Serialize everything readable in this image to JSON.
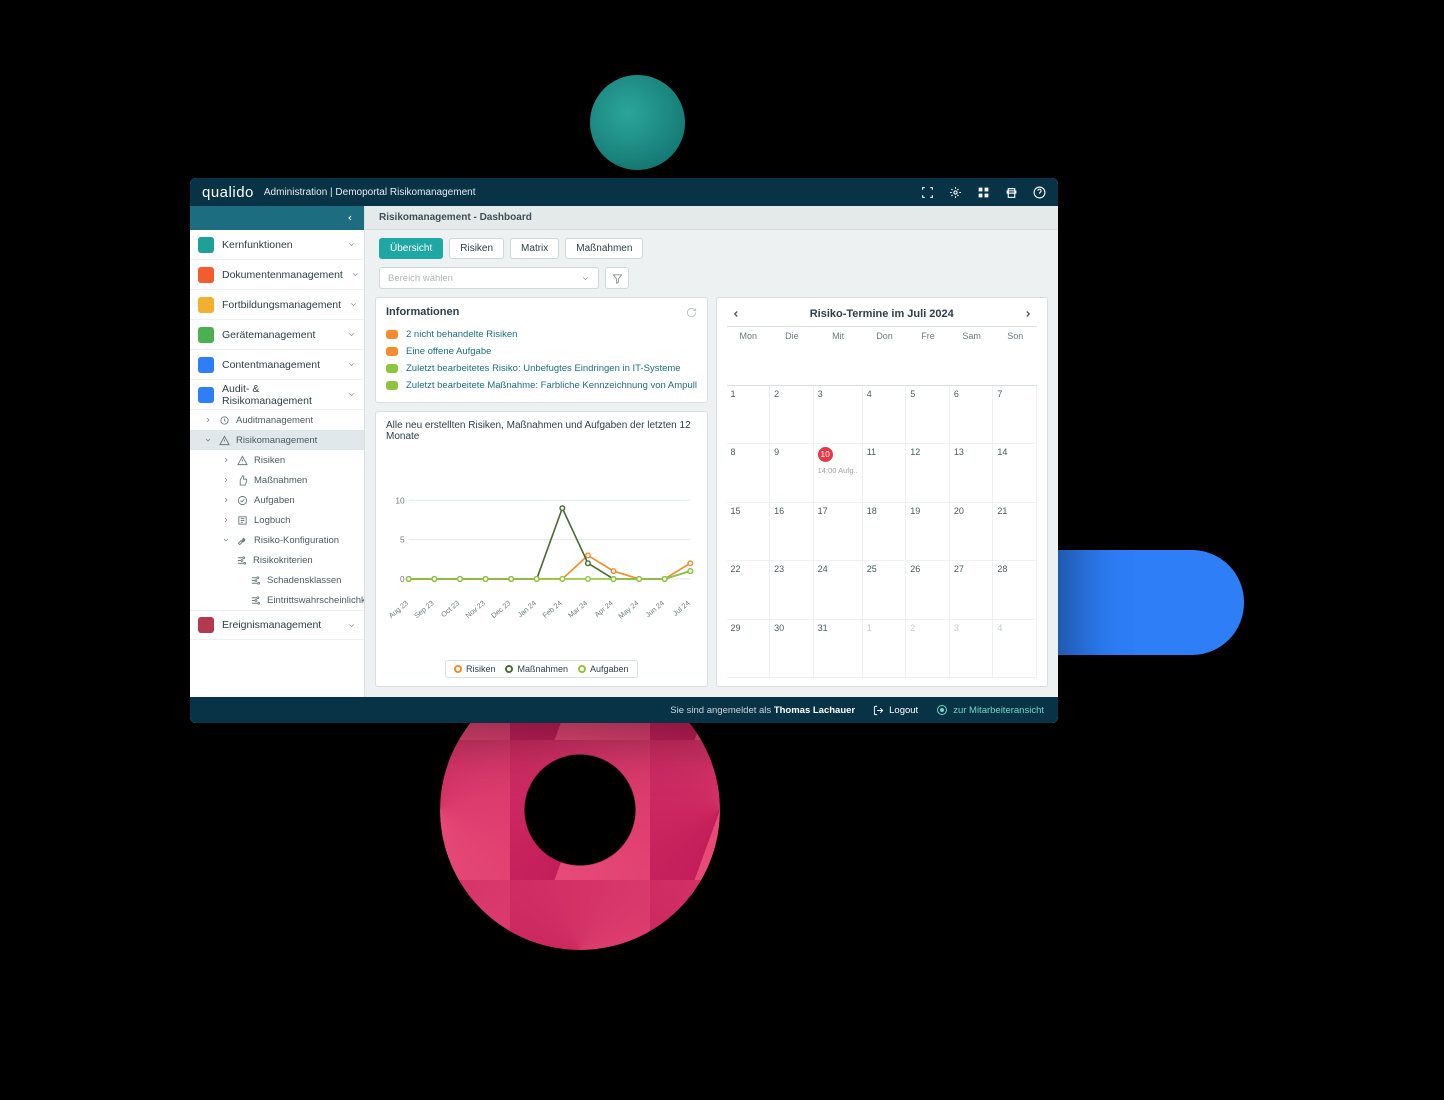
{
  "brand": "qualido",
  "header_subtitle": "Administration | Demoportal Risikomanagement",
  "sidebar": {
    "items": [
      {
        "label": "Kernfunktionen",
        "color": "#1fa096"
      },
      {
        "label": "Dokumentenmanagement",
        "color": "#f25c2e"
      },
      {
        "label": "Fortbildungsmanagement",
        "color": "#f2b02e"
      },
      {
        "label": "Gerätemanagement",
        "color": "#4caf50"
      },
      {
        "label": "Contentmanagement",
        "color": "#2d7ef7"
      },
      {
        "label": "Audit- & Risikomanagement",
        "color": "#2d7ef7"
      },
      {
        "label": "Ereignismanagement",
        "color": "#b33951"
      }
    ],
    "audit_sub": [
      {
        "label": "Auditmanagement",
        "depth": 1,
        "icon": "audit"
      },
      {
        "label": "Risikomanagement",
        "depth": 1,
        "icon": "warning",
        "sel": true
      },
      {
        "label": "Risiken",
        "depth": 2,
        "icon": "warning"
      },
      {
        "label": "Maßnahmen",
        "depth": 2,
        "icon": "thumbs-up"
      },
      {
        "label": "Aufgaben",
        "depth": 2,
        "icon": "check-circle"
      },
      {
        "label": "Logbuch",
        "depth": 2,
        "icon": "log"
      },
      {
        "label": "Risiko-Konfiguration",
        "depth": 2,
        "icon": "wrench"
      },
      {
        "label": "Risikokriterien",
        "depth": 3,
        "icon": "sliders"
      },
      {
        "label": "Schadensklassen",
        "depth": 4,
        "icon": "sliders"
      },
      {
        "label": "Eintrittswahrscheinlichkeit",
        "depth": 4,
        "icon": "sliders"
      }
    ]
  },
  "breadcrumb": "Risikomanagement - Dashboard",
  "tabs": [
    "Übersicht",
    "Risiken",
    "Matrix",
    "Maßnahmen"
  ],
  "active_tab": "Übersicht",
  "select_placeholder": "Bereich wählen",
  "info": {
    "title": "Informationen",
    "rows": [
      {
        "color": "#f28c2e",
        "text": "2 nicht behandelte Risiken"
      },
      {
        "color": "#f28c2e",
        "text": "Eine offene Aufgabe"
      },
      {
        "color": "#8cc63f",
        "text": "Zuletzt bearbeitetes Risiko: Unbefugtes Eindringen in IT-Systeme"
      },
      {
        "color": "#8cc63f",
        "text": "Zuletzt bearbeitete Maßnahme: Farbliche Kennzeichnung von Ampullen je nach Wirk"
      }
    ]
  },
  "calendar": {
    "title": "Risiko-Termine im Juli 2024",
    "dow": [
      "Mon",
      "Die",
      "Mit",
      "Don",
      "Fre",
      "Sam",
      "Son"
    ],
    "weeks": [
      [
        {
          "n": 1
        },
        {
          "n": 2
        },
        {
          "n": 3
        },
        {
          "n": 4
        },
        {
          "n": 5
        },
        {
          "n": 6
        },
        {
          "n": 7
        }
      ],
      [
        {
          "n": 8
        },
        {
          "n": 9
        },
        {
          "n": 10,
          "badge": true,
          "event": "14:00 Aufg.."
        },
        {
          "n": 11
        },
        {
          "n": 12
        },
        {
          "n": 13
        },
        {
          "n": 14
        }
      ],
      [
        {
          "n": 15
        },
        {
          "n": 16
        },
        {
          "n": 17
        },
        {
          "n": 18
        },
        {
          "n": 19
        },
        {
          "n": 20
        },
        {
          "n": 21
        }
      ],
      [
        {
          "n": 22
        },
        {
          "n": 23
        },
        {
          "n": 24
        },
        {
          "n": 25
        },
        {
          "n": 26
        },
        {
          "n": 27
        },
        {
          "n": 28
        }
      ],
      [
        {
          "n": 29
        },
        {
          "n": 30
        },
        {
          "n": 31
        },
        {
          "n": 1,
          "other": true
        },
        {
          "n": 2,
          "other": true
        },
        {
          "n": 3,
          "other": true
        },
        {
          "n": 4,
          "other": true
        }
      ]
    ]
  },
  "chart_data": {
    "type": "line",
    "title": "Alle neu erstellten Risiken, Maßnahmen und Aufgaben der letzten 12 Monate",
    "categories": [
      "Aug 23",
      "Sep 23",
      "Oct 23",
      "Nov 23",
      "Dec 23",
      "Jan 24",
      "Feb 24",
      "Mar 24",
      "Apr 24",
      "May 24",
      "Jun 24",
      "Jul 24"
    ],
    "ylim": [
      0,
      10
    ],
    "yticks": [
      0,
      5,
      10
    ],
    "series": [
      {
        "name": "Risiken",
        "color": "#f28c2e",
        "values": [
          0,
          0,
          0,
          0,
          0,
          0,
          0,
          3,
          1,
          0,
          0,
          2
        ]
      },
      {
        "name": "Maßnahmen",
        "color": "#4a6b3a",
        "values": [
          0,
          0,
          0,
          0,
          0,
          0,
          9,
          2,
          0,
          0,
          0,
          1
        ]
      },
      {
        "name": "Aufgaben",
        "color": "#8cc63f",
        "values": [
          0,
          0,
          0,
          0,
          0,
          0,
          0,
          0,
          0,
          0,
          0,
          1
        ]
      }
    ]
  },
  "footer": {
    "logged_in_prefix": "Sie sind angemeldet als ",
    "user": "Thomas Lachauer",
    "logout": "Logout",
    "switch": "zur Mitarbeiteransicht"
  }
}
